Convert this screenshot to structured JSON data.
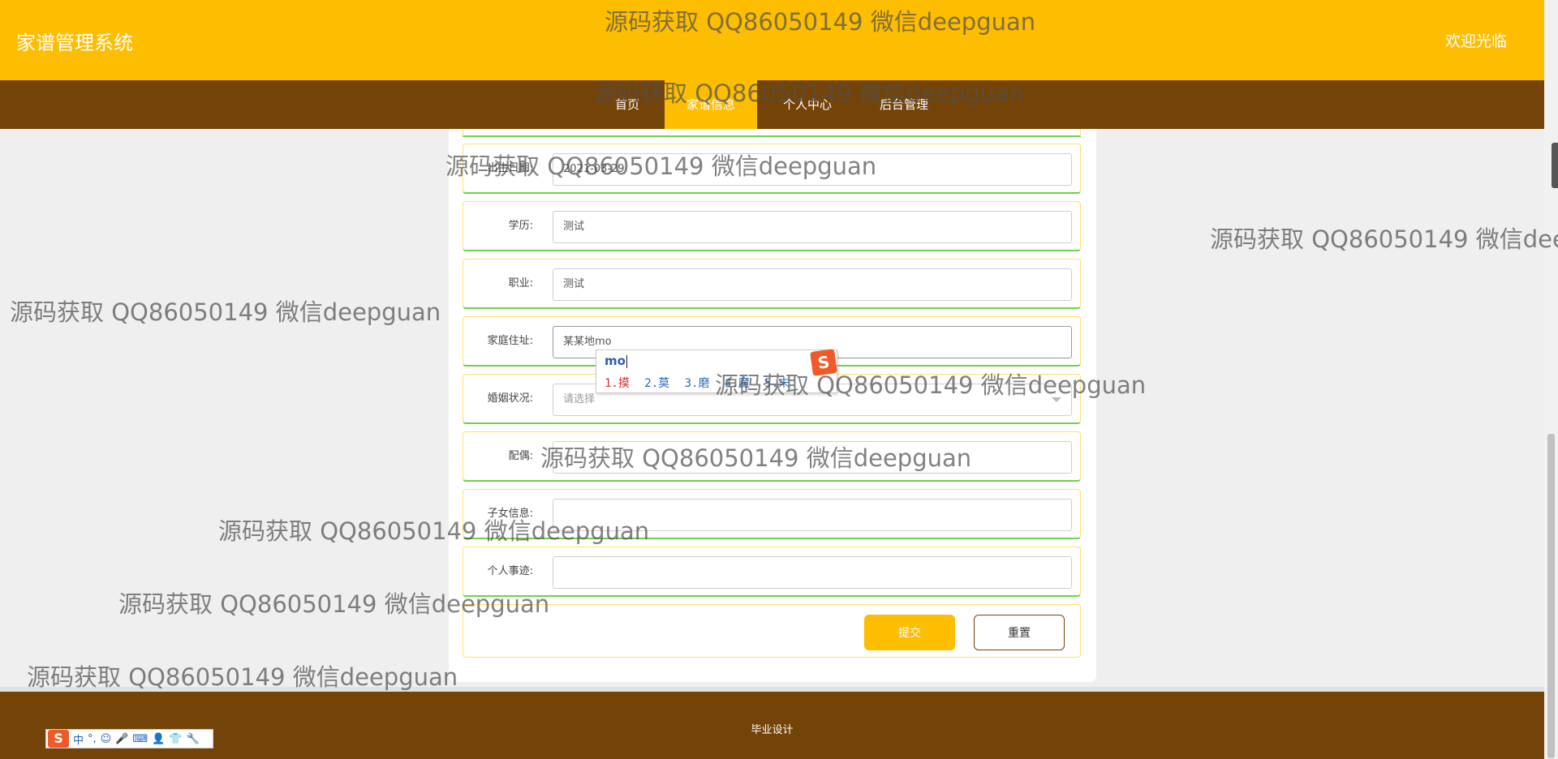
{
  "header": {
    "site_title": "家谱管理系统",
    "welcome": "欢迎光临"
  },
  "nav": {
    "items": [
      {
        "label": "首页",
        "active": false
      },
      {
        "label": "家谱信息",
        "active": true
      },
      {
        "label": "个人中心",
        "active": false
      },
      {
        "label": "后台管理",
        "active": false
      }
    ]
  },
  "form": {
    "birth_date": {
      "label": "出生日期:",
      "value": "2021-03-29"
    },
    "education": {
      "label": "学历:",
      "value": "测试"
    },
    "occupation": {
      "label": "职业:",
      "value": "测试"
    },
    "address": {
      "label": "家庭住址:",
      "value": "某某地mo"
    },
    "marital_status": {
      "label": "婚姻状况:",
      "placeholder": "请选择"
    },
    "spouse": {
      "label": "配偶:",
      "value": ""
    },
    "children": {
      "label": "子女信息:",
      "value": ""
    },
    "deeds": {
      "label": "个人事迹:",
      "value": ""
    },
    "submit_label": "提交",
    "reset_label": "重置"
  },
  "ime_popup": {
    "composition": "mo",
    "candidates": [
      "1.摸",
      "2.莫",
      "3.磨",
      "4.魔",
      "5.末"
    ]
  },
  "ime_toolbar": {
    "items": [
      "中",
      "°,",
      "☺",
      "🎤",
      "⌨",
      "👤",
      "👕",
      "🔧"
    ]
  },
  "footer": {
    "text": "毕业设计"
  },
  "watermark": {
    "text": "源码获取 QQ86050149 微信deepguan"
  },
  "colors": {
    "accent": "#fdbd01",
    "nav_brown": "#744307",
    "row_border_green": "#6fd14b"
  }
}
